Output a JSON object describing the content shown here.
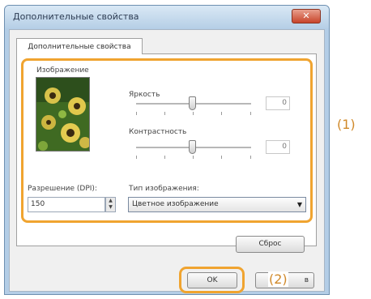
{
  "window": {
    "title": "Дополнительные свойства",
    "close_glyph": "✕"
  },
  "tab": {
    "label": "Дополнительные свойства"
  },
  "image_section": {
    "label": "Изображение",
    "brightness_label": "Яркость",
    "brightness_value": "0",
    "contrast_label": "Контрастность",
    "contrast_value": "0"
  },
  "resolution": {
    "label": "Разрешение (DPI):",
    "value": "150"
  },
  "image_type": {
    "label": "Тип изображения:",
    "selected": "Цветное изображение"
  },
  "buttons": {
    "reset": "Сброс",
    "ok": "OK",
    "help": "в"
  },
  "callouts": {
    "one": "(1)",
    "two": "(2)"
  },
  "colors": {
    "accent_orange": "#f0a430",
    "titlebar": "#b6cfe6"
  }
}
